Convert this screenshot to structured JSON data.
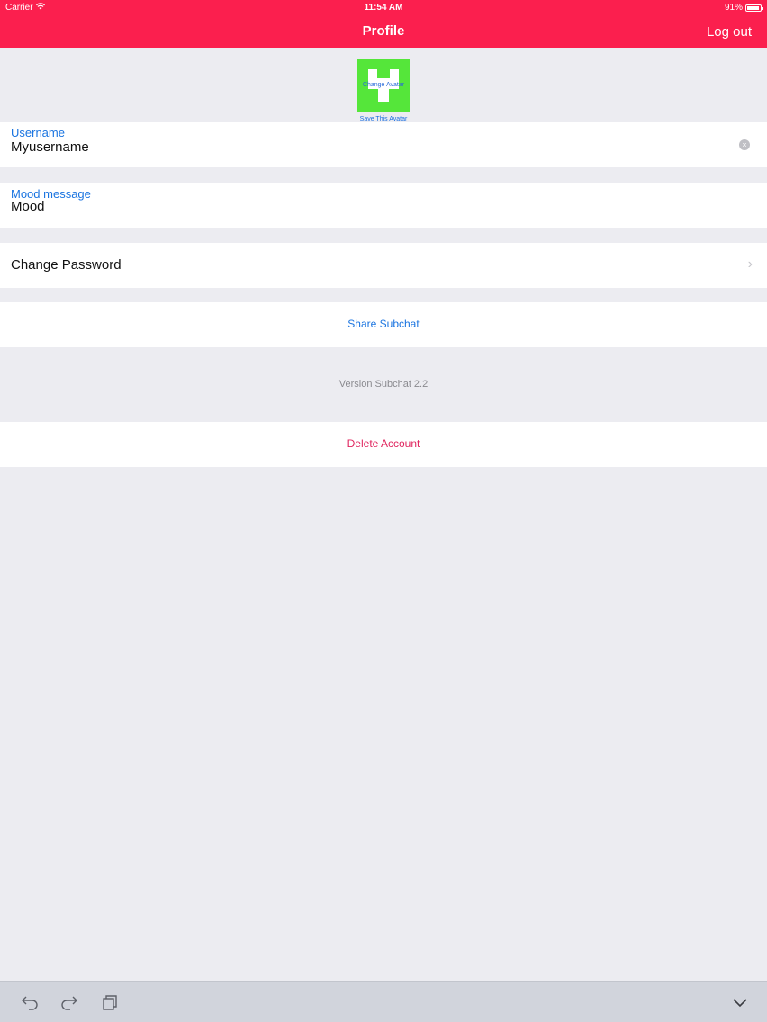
{
  "status_bar": {
    "carrier": "Carrier",
    "wifi_icon": "wifi-icon",
    "time": "11:54 AM",
    "battery_percent": "91%",
    "battery_level": 0.91
  },
  "nav": {
    "title": "Profile",
    "logout_label": "Log out",
    "bar_color": "#fb1f4e"
  },
  "avatar": {
    "change_label": "Change Avatar",
    "save_label": "Save This Avatar",
    "color": "#55e63a"
  },
  "fields": {
    "username": {
      "label": "Username",
      "value": "Myusername"
    },
    "mood": {
      "label": "Mood message",
      "value": "Mood"
    }
  },
  "rows": {
    "change_password": "Change Password",
    "share": "Share Subchat",
    "version": "Version Subchat 2.2",
    "delete": "Delete Account"
  },
  "colors": {
    "link_blue": "#1a74e0",
    "destructive": "#e0245e",
    "background": "#ececf1"
  },
  "shortcut_bar": {
    "icons": [
      "undo-icon",
      "redo-icon",
      "paste-icon",
      "keyboard-dismiss-icon"
    ]
  }
}
